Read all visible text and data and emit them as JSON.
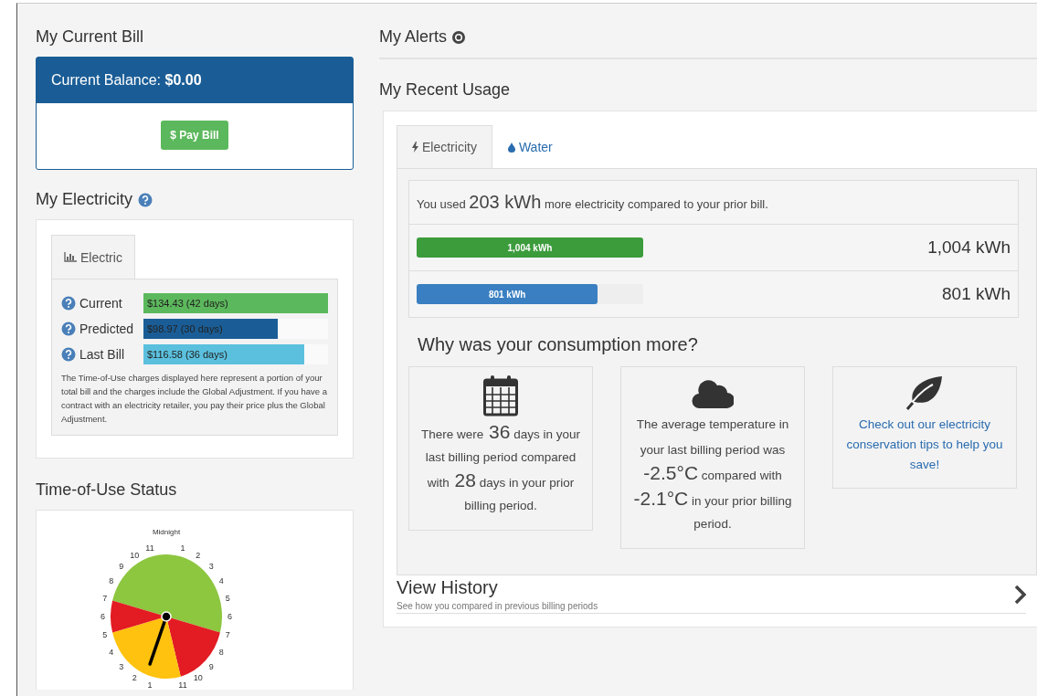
{
  "current_bill": {
    "heading": "My Current Bill",
    "balance_label": "Current Balance:",
    "balance": "$0.00",
    "pay_button": "$ Pay Bill"
  },
  "my_electricity": {
    "heading": "My Electricity",
    "tabs": [
      {
        "label": "Electric",
        "selected": true
      }
    ],
    "bars": [
      {
        "label": "Current",
        "value": "$134.43 (42 days)",
        "level": 1.0,
        "color": "#5cb85c"
      },
      {
        "label": "Predicted",
        "value": "$98.97 (30 days)",
        "level": 0.73,
        "color": "#1a5d96"
      },
      {
        "label": "Last Bill",
        "value": "$116.58 (36 days)",
        "level": 0.87,
        "color": "#5bc0de"
      }
    ],
    "note": "The Time-of-Use charges displayed here represent a portion of your total bill and the charges include the Global Adjustment. If you have a contract with an electricity retailer, you pay their price plus the Global Adjustment."
  },
  "time_of_use": {
    "heading": "Time-of-Use Status",
    "top_label": "Midnight",
    "right_hour_labels": [
      "1",
      "2",
      "3",
      "4",
      "5",
      "6",
      "7",
      "8",
      "9",
      "10",
      "11"
    ],
    "left_hour_labels": [
      "11",
      "10",
      "9",
      "8",
      "7",
      "6",
      "5",
      "4",
      "3",
      "2",
      "1"
    ]
  },
  "my_alerts": {
    "heading": "My Alerts"
  },
  "recent_usage": {
    "heading": "My Recent Usage",
    "tabs": [
      {
        "label": "Electricity",
        "kind": "bolt",
        "selected": true
      },
      {
        "label": "Water",
        "kind": "drop",
        "selected": false
      }
    ],
    "summary": {
      "before": "You used",
      "amount": "203 kWh",
      "after": "more electricity compared to your prior bill."
    },
    "bars": [
      {
        "label": "1,004 kWh",
        "reading": "1,004 kWh",
        "level": 1.0,
        "color": "#3c9c3c"
      },
      {
        "label": "801 kWh",
        "reading": "801 kWh",
        "level": 0.8,
        "color": "#3a7fc1"
      }
    ],
    "question": "Why was your consumption more?",
    "reasons": [
      {
        "kind": "calendar",
        "parts": [
          {
            "text": "There were",
            "big": false
          },
          {
            "text": "36",
            "big": true
          },
          {
            "text": "days in your last billing period compared with",
            "big": false
          },
          {
            "text": "28",
            "big": true
          },
          {
            "text": "days in your prior billing period.",
            "big": false
          }
        ]
      },
      {
        "kind": "cloud",
        "parts": [
          {
            "text": "The average temperature in your last billing period was",
            "big": false
          },
          {
            "text": "-2.5°C",
            "big": true
          },
          {
            "text": "compared with",
            "big": false
          },
          {
            "text": "-2.1°C",
            "big": true
          },
          {
            "text": "in your prior billing period.",
            "big": false
          }
        ]
      },
      {
        "kind": "leaf",
        "link": "Check out our electricity conservation tips to help you save!"
      }
    ],
    "history": {
      "title": "View History",
      "subtitle": "See how you compared in previous billing periods"
    }
  }
}
